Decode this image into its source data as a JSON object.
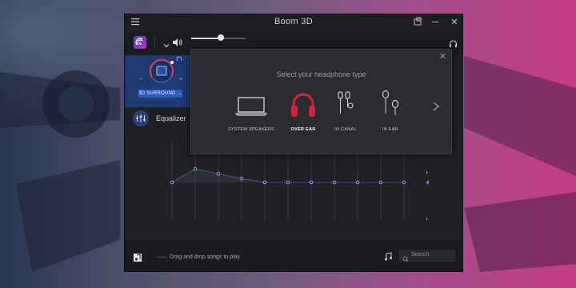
{
  "window": {
    "title": "Boom 3D"
  },
  "toolbar": {
    "volume_percent": 55
  },
  "surround": {
    "label": "3D SURROUND"
  },
  "equalizer": {
    "label": "Equalizer",
    "band_levels": [
      0,
      0.28,
      0.18,
      0.08,
      0,
      0,
      0,
      0,
      0,
      0,
      0
    ]
  },
  "footer": {
    "drop_text": "Drag and drop songs to play",
    "search_placeholder": "Search"
  },
  "popup": {
    "title": "Select your headphone type",
    "options": [
      {
        "label": "SYSTEM SPEAKERS",
        "icon": "laptop-icon",
        "selected": false
      },
      {
        "label": "OVER EAR",
        "icon": "over-ear-headphones-icon",
        "selected": true
      },
      {
        "label": "IN CANAL",
        "icon": "in-canal-earphones-icon",
        "selected": false
      },
      {
        "label": "IN EAR",
        "icon": "in-ear-earphones-icon",
        "selected": false
      }
    ]
  },
  "colors": {
    "accent": "#2b5bc0",
    "selected": "#d3243b",
    "background": "#1f2023"
  }
}
